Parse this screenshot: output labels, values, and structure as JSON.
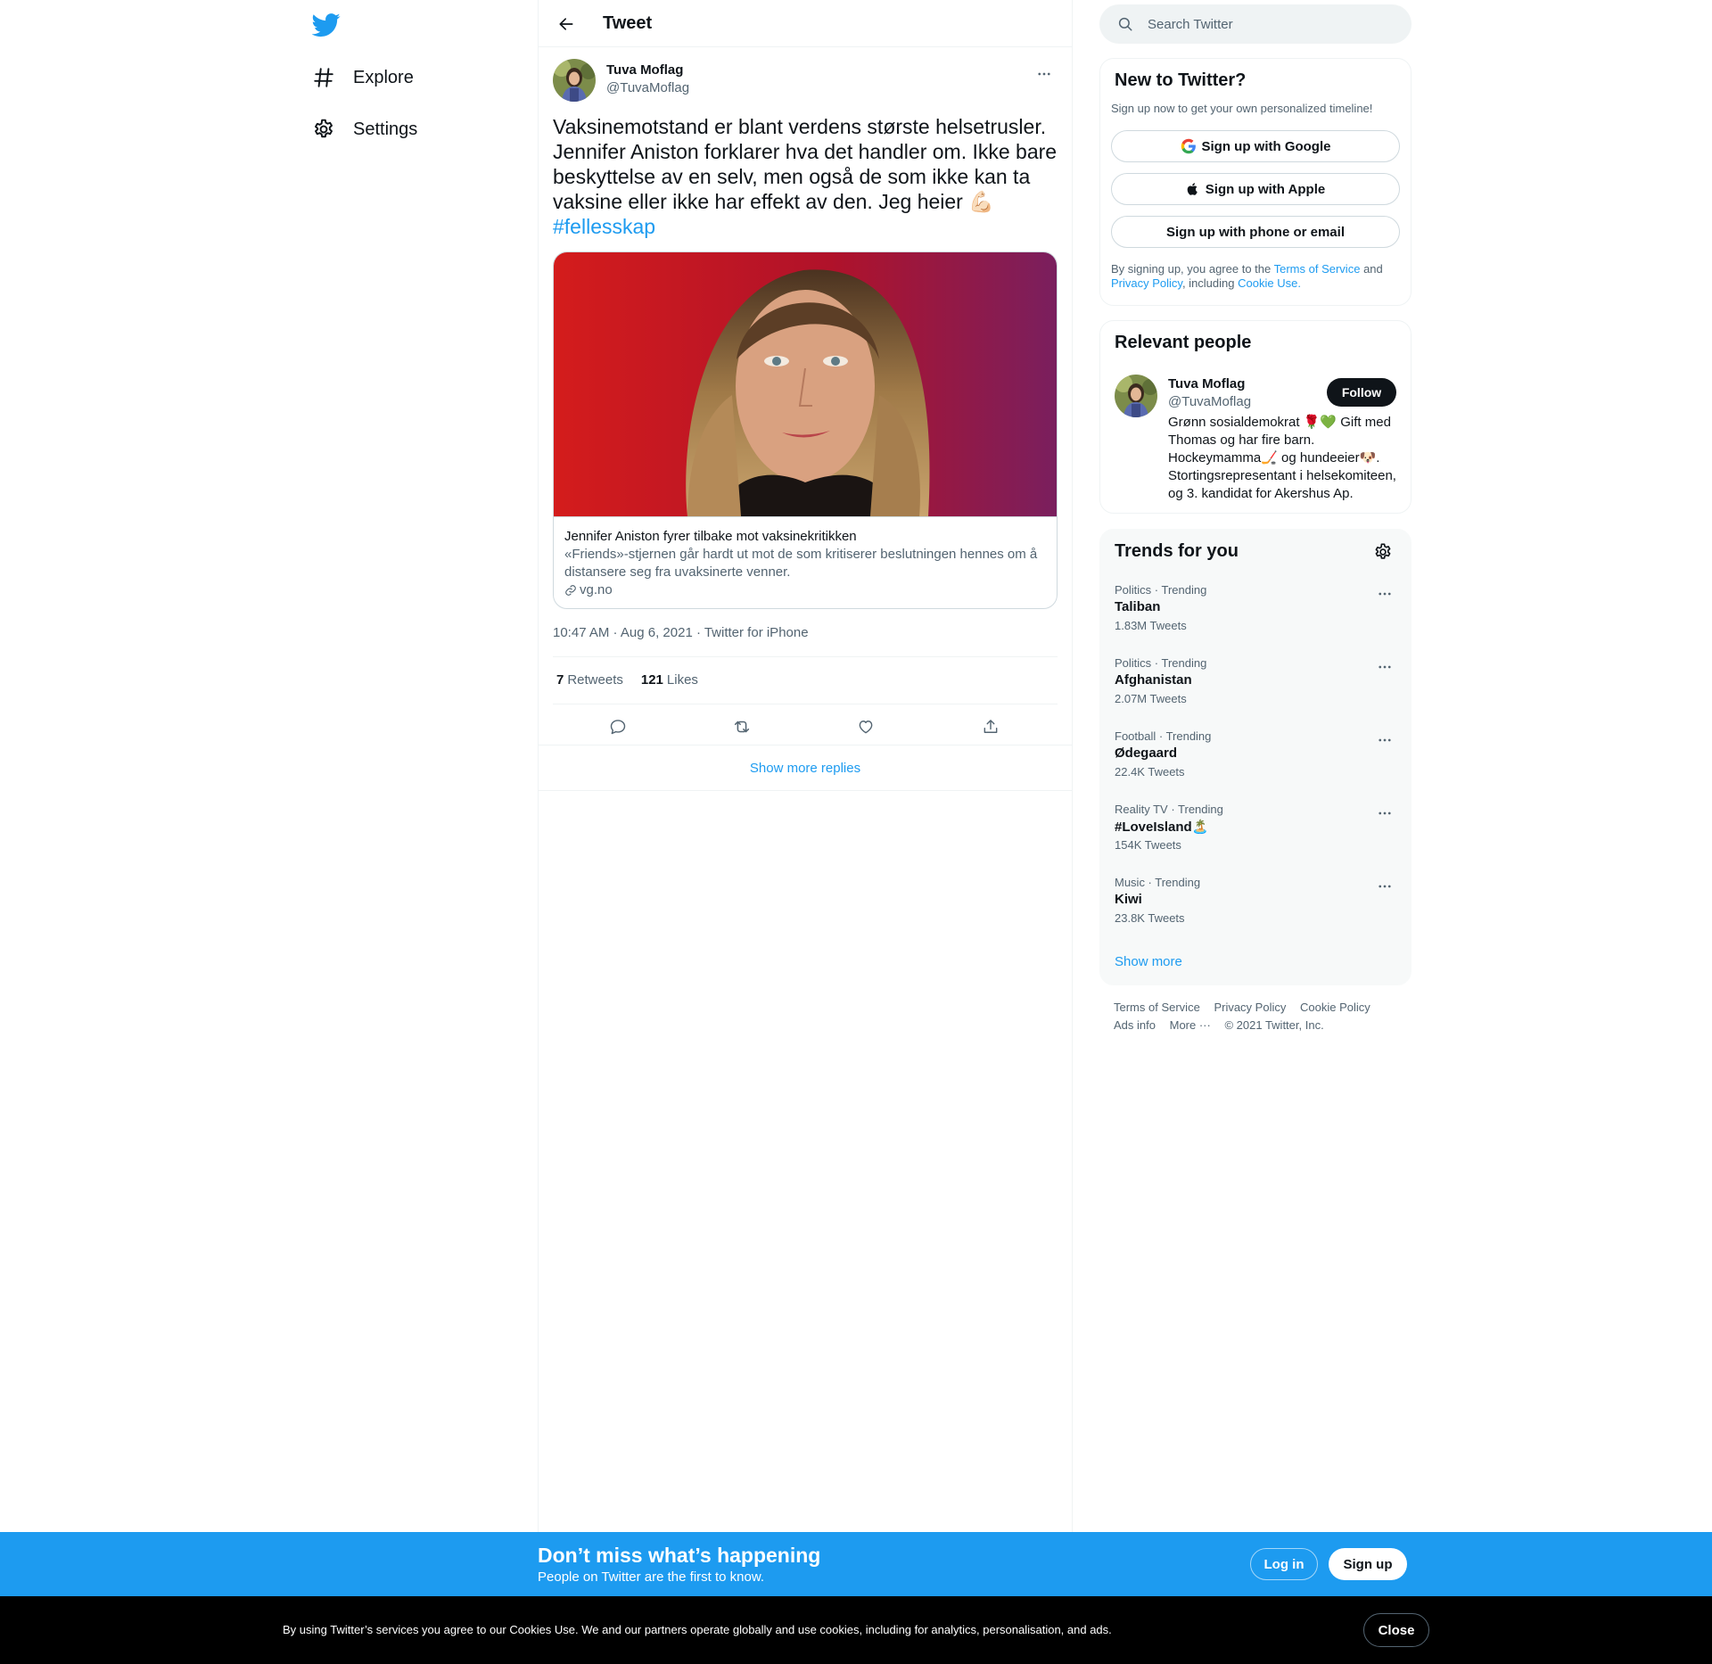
{
  "colors": {
    "brand": "#1d9bf0",
    "text_primary": "#0f1419",
    "text_secondary": "#536471",
    "border": "#eff3f4",
    "banner_bg": "#1d9bf0",
    "cookie_bg": "#000000"
  },
  "nav": {
    "logo_icon": "twitter-bird-icon",
    "items": [
      {
        "label": "Explore",
        "icon": "hashtag-icon"
      },
      {
        "label": "Settings",
        "icon": "gear-icon"
      }
    ]
  },
  "header": {
    "back_icon": "arrow-left-icon",
    "title": "Tweet"
  },
  "tweet": {
    "author_name": "Tuva Moflag",
    "author_handle": "@TuvaMoflag",
    "text": "Vaksinemotstand er blant verdens største helsetrusler. Jennifer Aniston forklarer hva det handler om. Ikke bare beskyttelse av en selv, men også de som ikke kan ta vaksine eller ikke har effekt av den. Jeg heier 💪🏻",
    "hashtag": "#fellesskap",
    "card": {
      "title": "Jennifer Aniston fyrer tilbake mot vaksinekritikken",
      "description": "«Friends»-stjernen går hardt ut mot de som kritiserer beslutningen hennes om å distansere seg fra uvaksinerte venner.",
      "domain": "vg.no",
      "link_icon": "link-icon"
    },
    "timestamp": "10:47 AM · Aug 6, 2021 · Twitter for iPhone",
    "retweets_count": "7",
    "retweets_label": "Retweets",
    "likes_count": "121",
    "likes_label": "Likes",
    "actions": [
      "reply-icon",
      "retweet-icon",
      "like-icon",
      "share-icon"
    ],
    "show_more_replies": "Show more replies"
  },
  "search": {
    "placeholder": "Search Twitter"
  },
  "new_to_twitter": {
    "title": "New to Twitter?",
    "subtitle": "Sign up now to get your own personalized timeline!",
    "google_label": "Sign up with Google",
    "apple_label": "Sign up with Apple",
    "phone_label": "Sign up with phone or email",
    "legal_prefix": "By signing up, you agree to the",
    "terms_label": "Terms of Service",
    "legal_and": "and",
    "privacy_label": "Privacy Policy",
    "legal_including": ", including",
    "cookie_label": "Cookie Use."
  },
  "relevant_people": {
    "title": "Relevant people",
    "name": "Tuva Moflag",
    "handle": "@TuvaMoflag",
    "follow_label": "Follow",
    "bio": "Grønn sosialdemokrat 🌹💚 Gift med Thomas og har fire barn. Hockeymamma🏒 og hundeeier🐶. Stortingsrepresentant i helsekomiteen, og 3. kandidat for Akershus Ap."
  },
  "trends": {
    "title": "Trends for you",
    "items": [
      {
        "context": "Politics · Trending",
        "name": "Taliban",
        "count": "1.83M Tweets"
      },
      {
        "context": "Politics · Trending",
        "name": "Afghanistan",
        "count": "2.07M Tweets"
      },
      {
        "context": "Football · Trending",
        "name": "Ødegaard",
        "count": "22.4K Tweets"
      },
      {
        "context": "Reality TV · Trending",
        "name": "#LoveIsland🏝️",
        "count": "154K Tweets"
      },
      {
        "context": "Music · Trending",
        "name": "Kiwi",
        "count": "23.8K Tweets"
      }
    ],
    "show_more": "Show more"
  },
  "footer": {
    "terms": "Terms of Service",
    "privacy": "Privacy Policy",
    "cookie": "Cookie Policy",
    "ads": "Ads info",
    "more": "More ···",
    "copyright": "© 2021 Twitter, Inc."
  },
  "banner": {
    "title": "Don’t miss what’s happening",
    "subtitle": "People on Twitter are the first to know.",
    "login_label": "Log in",
    "signup_label": "Sign up"
  },
  "cookie_bar": {
    "text": "By using Twitter’s services you agree to our Cookies Use. We and our partners operate globally and use cookies, including for analytics, personalisation, and ads.",
    "close_label": "Close"
  }
}
